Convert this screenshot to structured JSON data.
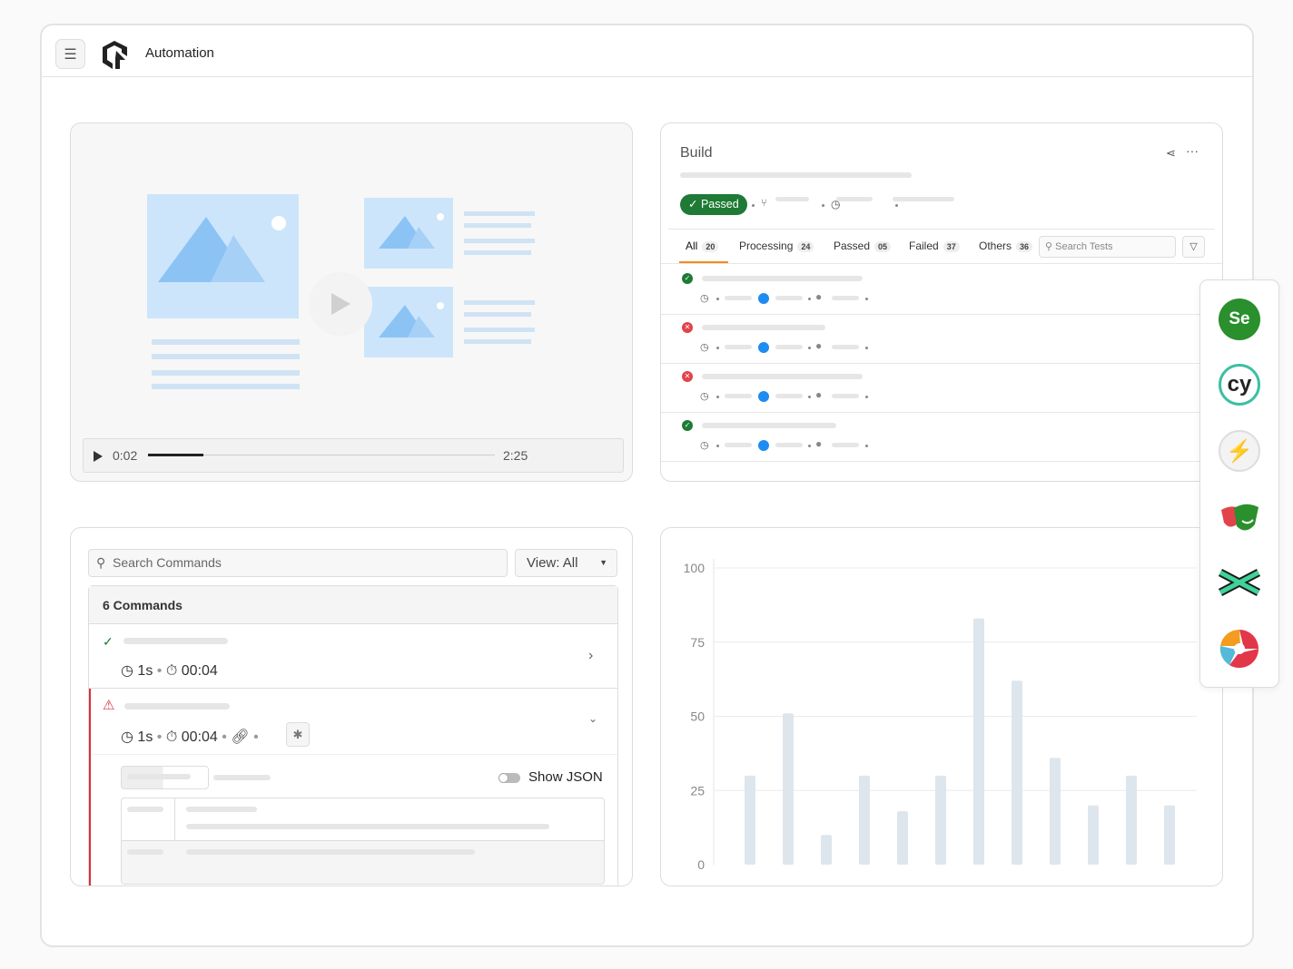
{
  "header": {
    "title": "Automation",
    "menu_icon": "hamburger-icon",
    "logo": "lambdatest-logo"
  },
  "video": {
    "current_time": "0:02",
    "duration": "2:25",
    "progress_fraction": 0.014
  },
  "build": {
    "title": "Build",
    "status": "Passed",
    "status_color": "#1e7a34",
    "tabs": [
      {
        "label": "All",
        "count": "20"
      },
      {
        "label": "Processing",
        "count": "24"
      },
      {
        "label": "Passed",
        "count": "05"
      },
      {
        "label": "Failed",
        "count": "37"
      },
      {
        "label": "Others",
        "count": "36"
      }
    ],
    "active_tab": "All",
    "accent": "#f58a1f",
    "search_placeholder": "Search Tests",
    "tests": [
      {
        "status": "passed"
      },
      {
        "status": "failed"
      },
      {
        "status": "failed"
      },
      {
        "status": "passed"
      }
    ]
  },
  "commands": {
    "search_placeholder": "Search Commands",
    "view_label": "View: All",
    "count_label": "6 Commands",
    "items": [
      {
        "status": "passed",
        "duration": "1s",
        "time": "00:04"
      },
      {
        "status": "error",
        "duration": "1s",
        "time": "00:04"
      }
    ],
    "show_json_label": "Show JSON",
    "show_json_on": false
  },
  "tools": [
    "selenium",
    "cypress",
    "k6",
    "playwright",
    "xcuitest",
    "espresso"
  ],
  "tool_labels": {
    "selenium": "Se",
    "cypress": "cy"
  },
  "chart_data": {
    "type": "bar",
    "ylim": [
      0,
      100
    ],
    "yticks": [
      "0",
      "25",
      "50",
      "75",
      "100"
    ],
    "grid": true,
    "values": [
      30,
      51,
      10,
      30,
      18,
      30,
      83,
      62,
      36,
      20,
      30,
      20
    ],
    "bar_color": "#dde6ec"
  }
}
